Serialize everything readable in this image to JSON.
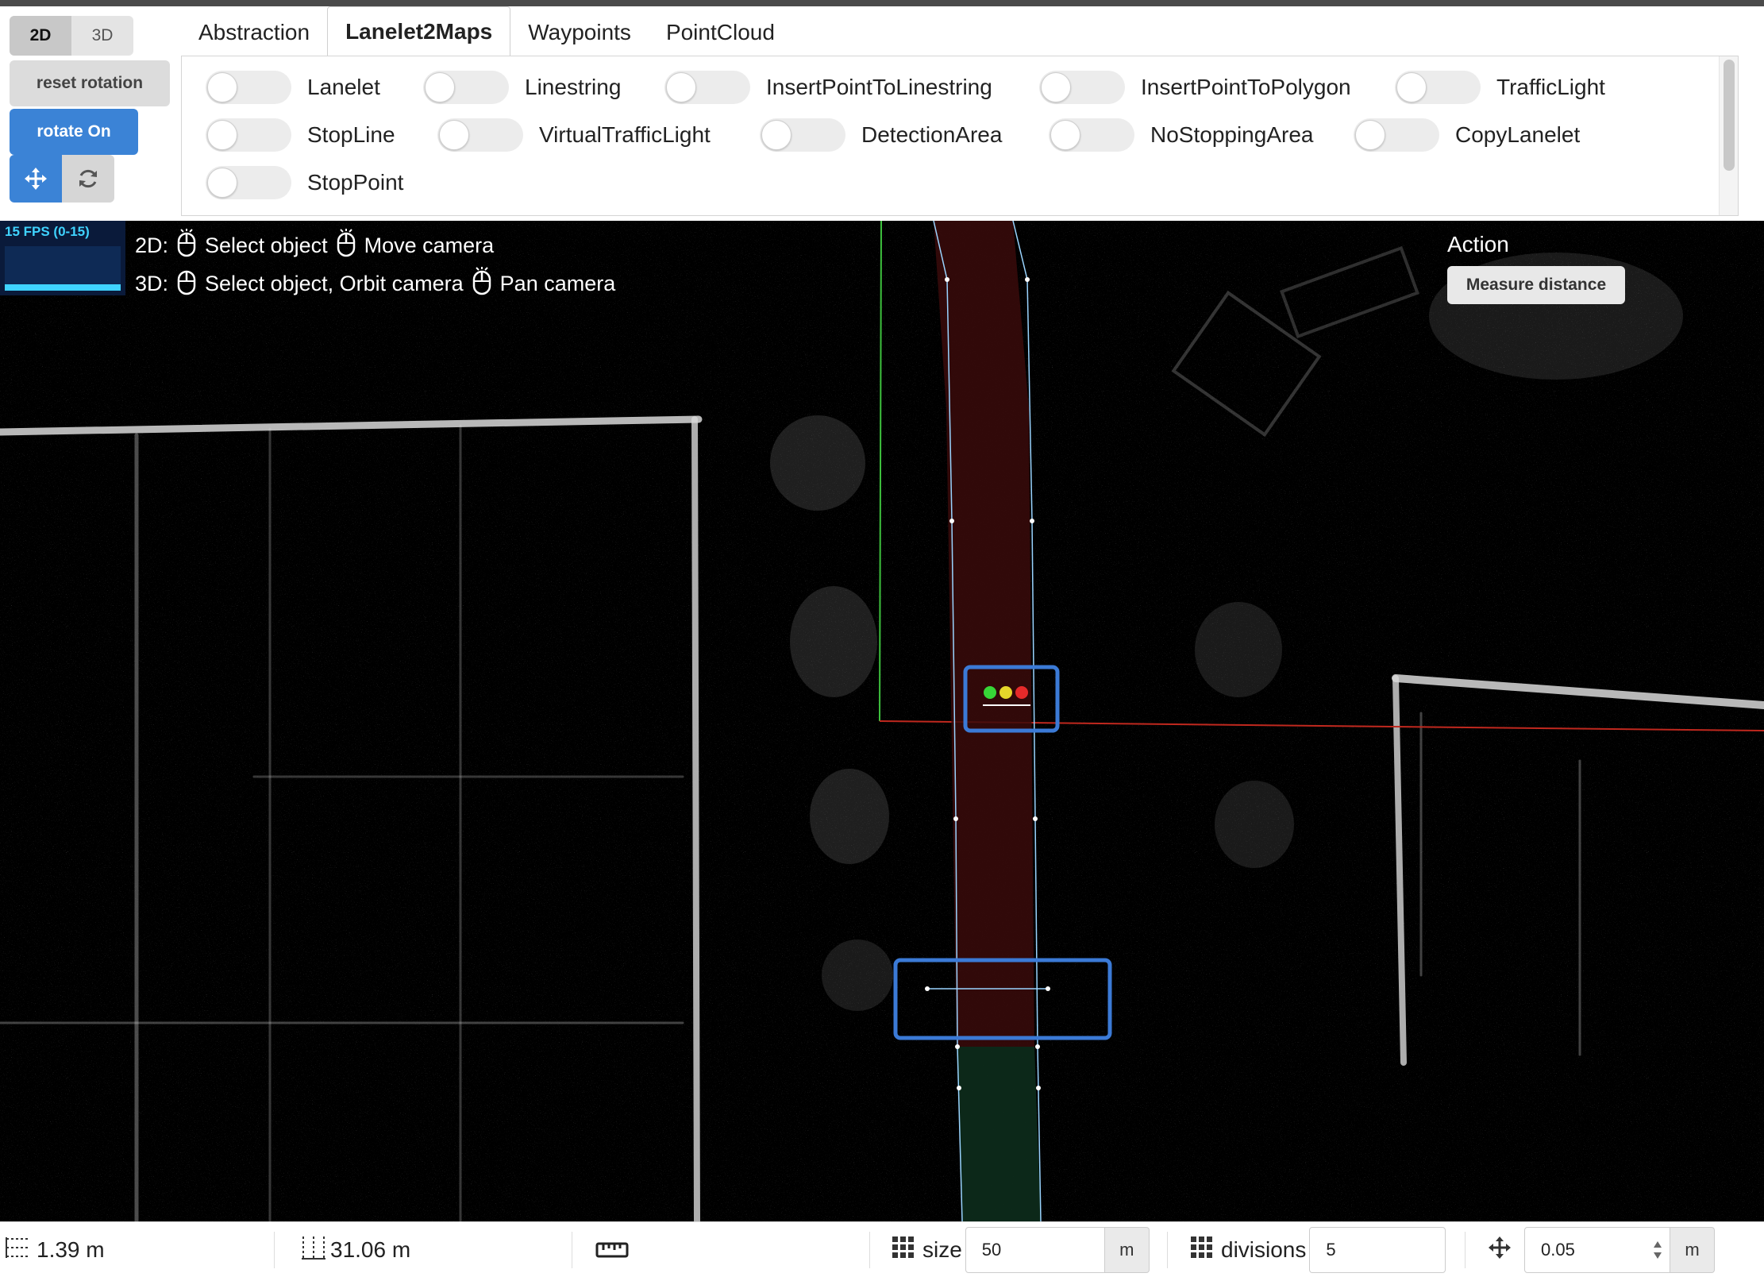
{
  "left_panel": {
    "mode_2d": "2D",
    "mode_3d": "3D",
    "active_mode": "2D",
    "reset_rotation": "reset rotation",
    "rotate_on": "rotate On",
    "icons": [
      "move-icon",
      "refresh-icon"
    ]
  },
  "tabs": [
    {
      "label": "Abstraction",
      "active": false
    },
    {
      "label": "Lanelet2Maps",
      "active": true
    },
    {
      "label": "Waypoints",
      "active": false
    },
    {
      "label": "PointCloud",
      "active": false
    }
  ],
  "toggles": [
    {
      "label": "Lanelet",
      "on": false
    },
    {
      "label": "Linestring",
      "on": false
    },
    {
      "label": "InsertPointToLinestring",
      "on": false
    },
    {
      "label": "InsertPointToPolygon",
      "on": false
    },
    {
      "label": "TrafficLight",
      "on": false
    },
    {
      "label": "StopLine",
      "on": false
    },
    {
      "label": "VirtualTrafficLight",
      "on": false
    },
    {
      "label": "DetectionArea",
      "on": false
    },
    {
      "label": "NoStoppingArea",
      "on": false
    },
    {
      "label": "CopyLanelet",
      "on": false
    },
    {
      "label": "StopPoint",
      "on": false
    }
  ],
  "viewport": {
    "fps": "15 FPS (0-15)",
    "help_2d_prefix": "2D:",
    "help_2d_select": "Select object",
    "help_2d_move": "Move camera",
    "help_3d_prefix": "3D:",
    "help_3d_select": "Select object, Orbit camera",
    "help_3d_pan": "Pan camera",
    "action_title": "Action",
    "measure_button": "Measure distance",
    "colors": {
      "lanelet_red": "#3a0a0a",
      "lanelet_green": "#0d2a1a",
      "selection": "#3b7ad6",
      "axis_red": "#c0281e",
      "axis_green": "#3ec23e"
    }
  },
  "statusbar": {
    "grid_spacing": "1.39 m",
    "grid_extent": "31.06 m",
    "size_label": "size",
    "size_value": "50",
    "size_unit": "m",
    "divisions_label": "divisions",
    "divisions_value": "5",
    "snap_value": "0.05",
    "snap_unit": "m"
  }
}
